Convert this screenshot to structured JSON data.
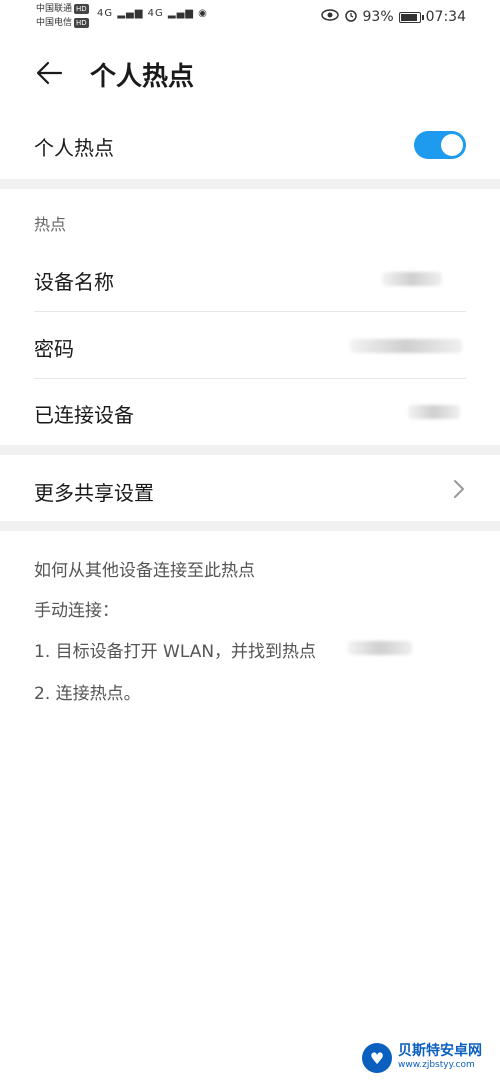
{
  "status_bar": {
    "carrier1": "中国联通",
    "carrier2": "中国电信",
    "hd_badge": "HD",
    "network_type": "4G",
    "battery": "93%",
    "battery_level": 0.93,
    "time": "07:34",
    "icons": [
      "signal-icon",
      "wifi-hotspot-icon",
      "eye-icon",
      "alarm-icon",
      "battery-icon"
    ]
  },
  "header": {
    "title": "个人热点",
    "back_icon": "arrow-left-icon"
  },
  "hotspot_toggle": {
    "label": "个人热点",
    "on": true,
    "accent": "#1e9bef"
  },
  "hotspot_section": {
    "header": "热点",
    "items": [
      {
        "label": "设备名称"
      },
      {
        "label": "密码"
      },
      {
        "label": "已连接设备"
      }
    ]
  },
  "more_sharing": {
    "label": "更多共享设置",
    "icon": "chevron-right-icon"
  },
  "help": {
    "title": "如何从其他设备连接至此热点",
    "manual": "手动连接：",
    "step1": "1. 目标设备打开 WLAN，并找到热点",
    "step2": "2. 连接热点。"
  },
  "watermark": {
    "name": "贝斯特安卓网",
    "url": "www.zjbstyy.com"
  }
}
